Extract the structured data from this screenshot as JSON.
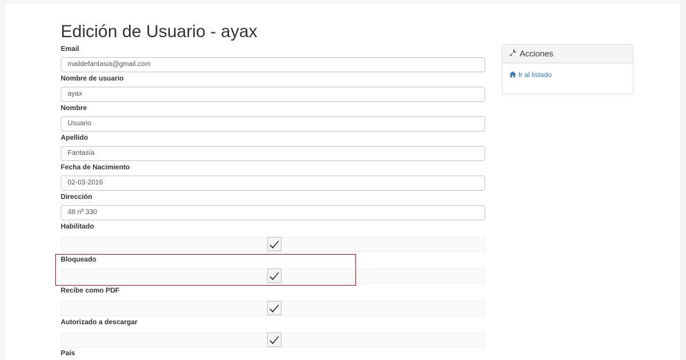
{
  "page": {
    "title": "Edición de Usuario - ayax"
  },
  "form": {
    "email_label": "Email",
    "email_value": "maildefantasia@gmail.com",
    "username_label": "Nombre de usuario",
    "username_value": "ayax",
    "name_label": "Nombre",
    "name_value": "Usuario",
    "lastname_label": "Apellido",
    "lastname_value": "Fantasía",
    "birthdate_label": "Fecha de Nacimiento",
    "birthdate_value": "02-03-2016",
    "address_label": "Dirección",
    "address_value": "48 nº 330",
    "enabled_label": "Habilitado",
    "enabled_checked": true,
    "blocked_label": "Bloqueado",
    "blocked_checked": true,
    "pdf_label": "Recibe como PDF",
    "pdf_checked": true,
    "download_label": "Autorizado a descargar",
    "download_checked": true,
    "country_label": "País"
  },
  "sidebar": {
    "heading": "Acciones",
    "heading_icon": "wrench-icon",
    "link_label": "Ir al listado",
    "link_icon": "home-icon",
    "link_color": "#337ab7"
  },
  "annotation": {
    "highlight_color": "#d9232d"
  }
}
